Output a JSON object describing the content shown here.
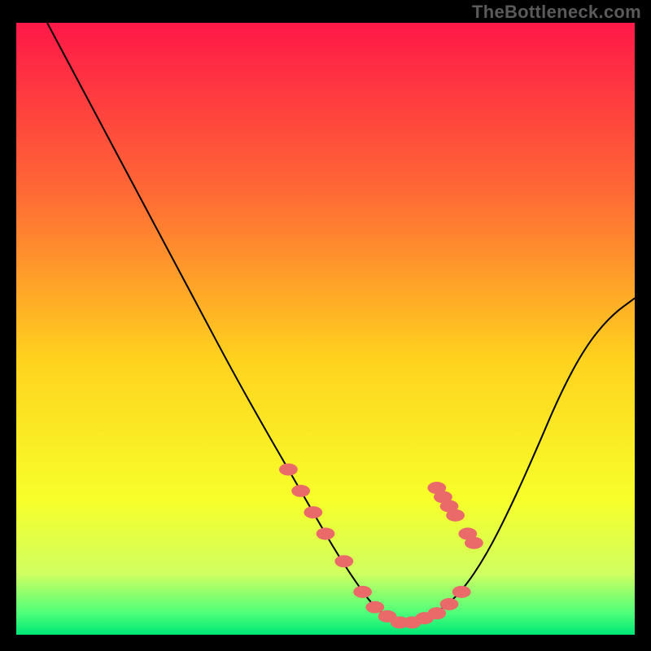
{
  "watermark": "TheBottleneck.com",
  "colors": {
    "frame": "#000000",
    "curve": "#000000",
    "markers": "#ea6a6a",
    "grad_top": "#ff1848",
    "grad_mid1": "#ff6a35",
    "grad_mid2": "#ffd21e",
    "grad_mid3": "#f7ff2a",
    "grad_low1": "#d0ff60",
    "grad_low2": "#4dff7a",
    "grad_bottom": "#00e676"
  },
  "chart_data": {
    "type": "line",
    "title": "",
    "xlabel": "",
    "ylabel": "",
    "xlim": [
      0,
      100
    ],
    "ylim": [
      0,
      100
    ],
    "series": [
      {
        "name": "curve",
        "x": [
          5,
          10,
          15,
          20,
          25,
          30,
          35,
          40,
          44,
          48,
          52,
          56,
          58,
          60,
          62,
          64,
          68,
          72,
          76,
          80,
          84,
          88,
          92,
          96,
          100
        ],
        "y": [
          100,
          90.5,
          81,
          71.5,
          62,
          52.5,
          43,
          34,
          27,
          20,
          13,
          7,
          4.5,
          3,
          2,
          2,
          3.5,
          7,
          13,
          21,
          30,
          39.5,
          47,
          52,
          55
        ]
      }
    ],
    "markers": {
      "name": "highlight-points",
      "x": [
        44,
        46,
        48,
        50,
        53,
        56,
        58,
        60,
        62,
        64,
        66,
        68,
        70,
        72,
        68,
        69,
        70,
        71,
        73,
        74
      ],
      "y": [
        27,
        23.5,
        20,
        16.5,
        12,
        7,
        4.5,
        3,
        2,
        2,
        2.7,
        3.5,
        5,
        7,
        24,
        22.5,
        21,
        19.5,
        16.5,
        15
      ]
    }
  }
}
